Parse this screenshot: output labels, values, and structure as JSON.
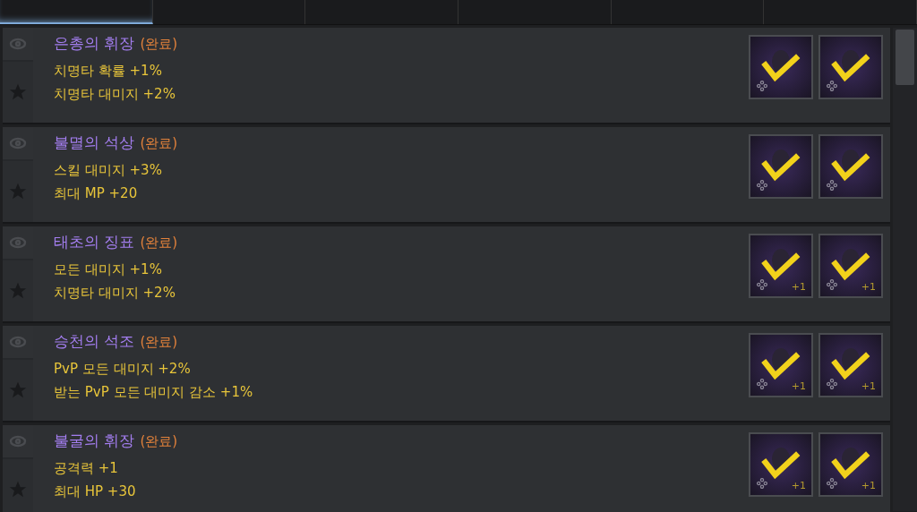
{
  "tabs": [
    {
      "selected": true
    },
    {
      "selected": false
    },
    {
      "selected": false
    },
    {
      "selected": false
    },
    {
      "selected": false
    },
    {
      "selected": false
    }
  ],
  "collections": [
    {
      "title": "은총의 휘장",
      "status": "(완료)",
      "stats": [
        "치명타 확률 +1%",
        "치명타 대미지 +2%"
      ],
      "slots": [
        {
          "checked": true
        },
        {
          "checked": true
        }
      ]
    },
    {
      "title": "불멸의 석상",
      "status": "(완료)",
      "stats": [
        "스킬 대미지 +3%",
        "최대 MP +20"
      ],
      "slots": [
        {
          "checked": true
        },
        {
          "checked": true
        }
      ]
    },
    {
      "title": "태초의 징표",
      "status": "(완료)",
      "stats": [
        "모든 대미지 +1%",
        "치명타 대미지 +2%"
      ],
      "slots": [
        {
          "checked": true,
          "badge": "+1"
        },
        {
          "checked": true,
          "badge": "+1"
        }
      ]
    },
    {
      "title": "승천의 석조",
      "status": "(완료)",
      "stats": [
        "PvP 모든 대미지 +2%",
        "받는 PvP 모든 대미지 감소 +1%"
      ],
      "slots": [
        {
          "checked": true,
          "badge": "+1"
        },
        {
          "checked": true,
          "badge": "+1"
        }
      ]
    },
    {
      "title": "불굴의 휘장",
      "status": "(완료)",
      "stats": [
        "공격력 +1",
        "최대 HP +30"
      ],
      "slots": [
        {
          "checked": true,
          "badge": "+1"
        },
        {
          "checked": true,
          "badge": "+1"
        }
      ]
    }
  ]
}
